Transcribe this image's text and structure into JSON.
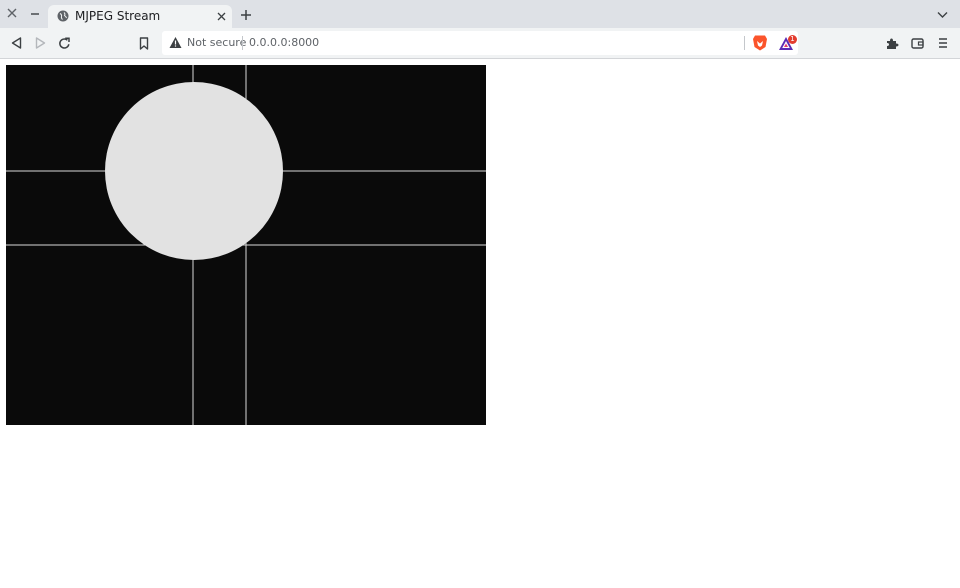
{
  "window": {
    "close_icon": "close-icon",
    "minimize_icon": "minimize-icon"
  },
  "tab": {
    "title": "MJPEG Stream",
    "favicon": "globe-icon",
    "close_icon": "close-icon"
  },
  "new_tab_icon": "plus-icon",
  "tab_search_icon": "chevron-down-icon",
  "toolbar": {
    "back_icon": "back-icon",
    "forward_icon": "forward-icon",
    "reload_icon": "reload-icon",
    "bookmark_icon": "bookmark-icon",
    "extensions_icon": "puzzle-icon",
    "wallet_icon": "wallet-icon",
    "menu_icon": "menu-icon"
  },
  "omnibox": {
    "security_label": "Not secure",
    "url": "0.0.0.0:8000",
    "warning_icon": "warning-triangle-icon"
  },
  "brave_shields_icon": "brave-lion-icon",
  "rewards": {
    "icon": "brave-rewards-icon",
    "badge_count": "1"
  },
  "colors": {
    "tabstrip": "#dee1e6",
    "toolbar": "#f1f3f4",
    "stream_background": "#0a0a0a",
    "stream_lines": "#d8d8d8",
    "stream_circle": "#e2e2e2",
    "brave_orange": "#fb542b",
    "rewards_badge": "#e33d2f"
  }
}
